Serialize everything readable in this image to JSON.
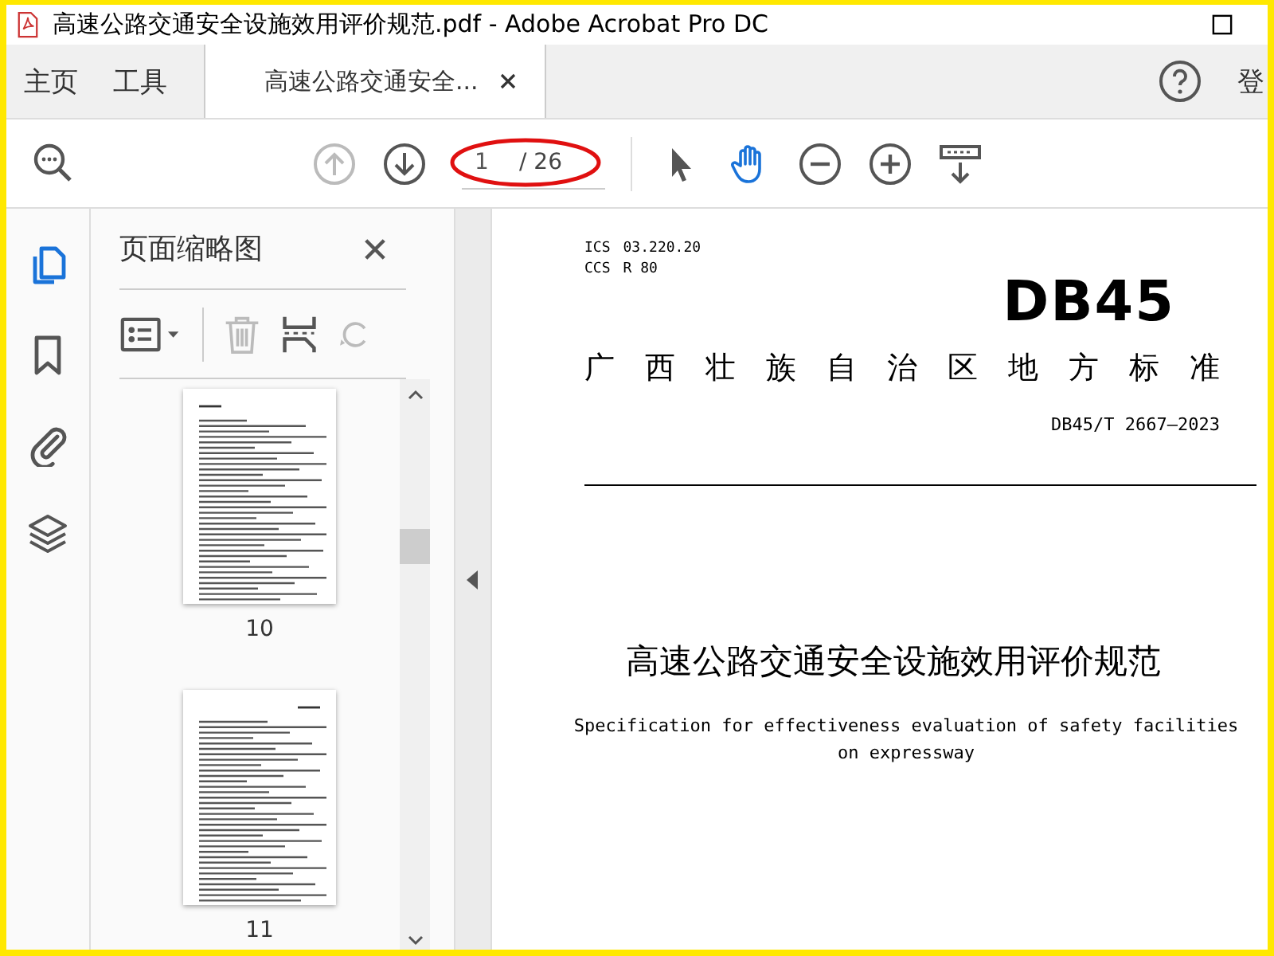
{
  "window": {
    "title": "高速公路交通安全设施效用评价规范.pdf - Adobe Acrobat Pro DC"
  },
  "tabs": [
    {
      "label": "主页",
      "selected": false
    },
    {
      "label": "工具",
      "selected": false
    },
    {
      "label": "高速公路交通安全...",
      "selected": true
    }
  ],
  "account_label": "登",
  "toolbar": {
    "prev_disabled": true,
    "next_disabled": false,
    "page_input": "1",
    "page_total": "/ 26",
    "hand_selected": true
  },
  "left_rail": [
    {
      "kind": "pages",
      "selected": true
    },
    {
      "kind": "bookmark",
      "selected": false
    },
    {
      "kind": "attachment",
      "selected": false
    },
    {
      "kind": "layers",
      "selected": false
    }
  ],
  "panel": {
    "title": "页面缩略图",
    "delete_disabled": true,
    "rotate_disabled": true,
    "thumbnails": [
      {
        "label": "10"
      },
      {
        "label": "11"
      }
    ]
  },
  "document": {
    "ics_label": "ICS",
    "ics_code": "03.220.20",
    "ccs_label": "CCS",
    "ccs_code": "R 80",
    "logo": "DB45",
    "category": "广西壮族自治区地方标准",
    "number": "DB45/T 2667—2023",
    "title": "高速公路交通安全设施效用评价规范",
    "subtitle": "Specification for effectiveness evaluation of safety facilities on expressway"
  }
}
